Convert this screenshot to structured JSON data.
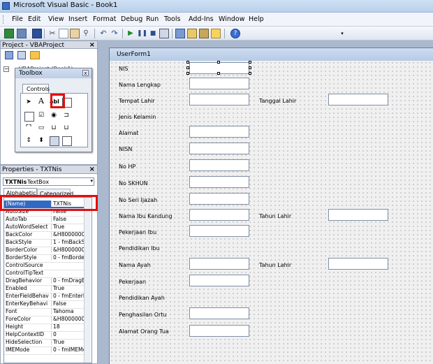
{
  "app": {
    "title": "Microsoft Visual Basic - Book1"
  },
  "menu": [
    "File",
    "Edit",
    "View",
    "Insert",
    "Format",
    "Debug",
    "Run",
    "Tools",
    "Add-Ins",
    "Window",
    "Help"
  ],
  "project": {
    "title": "Project - VBAProject",
    "tree_label": "VBAProject (Book1)"
  },
  "toolbox": {
    "title": "Toolbox",
    "tab": "Controls",
    "selected_tool": "abl"
  },
  "properties": {
    "title": "Properties - TXTNis",
    "object_name": "TXTNis",
    "object_type": "TextBox",
    "tabs": [
      "Alphabetic",
      "Categorized"
    ],
    "rows": [
      {
        "name": "(Name)",
        "value": "TXTNis"
      },
      {
        "name": "AutoSize",
        "value": "False"
      },
      {
        "name": "AutoTab",
        "value": "False"
      },
      {
        "name": "AutoWordSelect",
        "value": "True"
      },
      {
        "name": "BackColor",
        "value": "&H8000000"
      },
      {
        "name": "BackStyle",
        "value": "1 - fmBackStyle"
      },
      {
        "name": "BorderColor",
        "value": "&H8000000"
      },
      {
        "name": "BorderStyle",
        "value": "0 - fmBorderSt"
      },
      {
        "name": "ControlSource",
        "value": ""
      },
      {
        "name": "ControlTipText",
        "value": ""
      },
      {
        "name": "DragBehavior",
        "value": "0 - fmDragBeh"
      },
      {
        "name": "Enabled",
        "value": "True"
      },
      {
        "name": "EnterFieldBehav",
        "value": "0 - fmEnterFiel"
      },
      {
        "name": "EnterKeyBehavi",
        "value": "False"
      },
      {
        "name": "Font",
        "value": "Tahoma"
      },
      {
        "name": "ForeColor",
        "value": "&H8000000"
      },
      {
        "name": "Height",
        "value": "18"
      },
      {
        "name": "HelpContextID",
        "value": "0"
      },
      {
        "name": "HideSelection",
        "value": "True"
      },
      {
        "name": "IMEMode",
        "value": "0 - fmIMEMode"
      }
    ]
  },
  "form": {
    "caption": "UserForm1",
    "labels": [
      "NIS",
      "Nama Lengkap",
      "Tempat Lahir",
      "Jenis Kelamin",
      "Alamat",
      "NISN",
      "No HP",
      "No SKHUN",
      "No Seri Ijazah",
      "Nama Ibu Kandung",
      "Pekerjaan Ibu",
      "Pendidikan Ibu",
      "Nama Ayah",
      "Pekerjaan",
      "Pendidikan Ayah",
      "Penghasilan Ortu",
      "Alamat Orang Tua"
    ],
    "right_labels": [
      "Tanggal Lahir",
      "Tahun Lahir",
      "Tahun Lahir"
    ]
  },
  "colors": {
    "highlight_red": "#e01010",
    "selected_row": "#316ac5"
  }
}
